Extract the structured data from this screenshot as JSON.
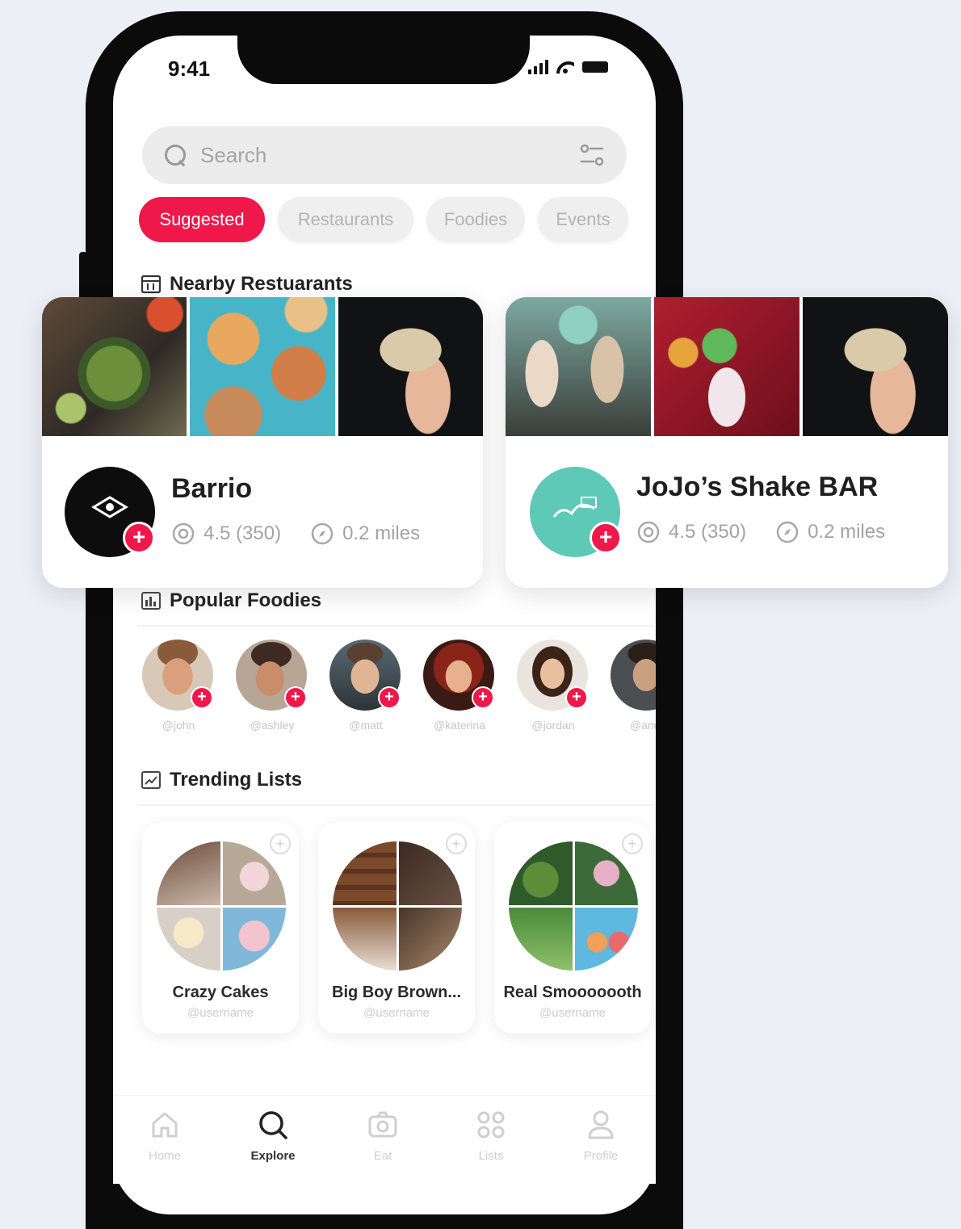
{
  "status": {
    "time": "9:41"
  },
  "search": {
    "placeholder": "Search"
  },
  "chips": [
    "Suggested",
    "Restaurants",
    "Foodies",
    "Events"
  ],
  "sections": {
    "nearby": "Nearby Restuarants",
    "foodies": "Popular Foodies",
    "trending": "Trending Lists"
  },
  "restaurants": [
    {
      "name": "Barrio",
      "rating": "4.5 (350)",
      "distance": "0.2 miles"
    },
    {
      "name": "JoJo’s Shake BAR",
      "rating": "4.5 (350)",
      "distance": "0.2 miles"
    }
  ],
  "foodies": [
    {
      "handle": "@john"
    },
    {
      "handle": "@ashley"
    },
    {
      "handle": "@matt"
    },
    {
      "handle": "@katerina"
    },
    {
      "handle": "@jordan"
    },
    {
      "handle": "@andr"
    }
  ],
  "lists": [
    {
      "title": "Crazy Cakes",
      "user": "@username"
    },
    {
      "title": "Big Boy Brown...",
      "user": "@username"
    },
    {
      "title": "Real Smooooooth",
      "user": "@username"
    }
  ],
  "tabs": [
    "Home",
    "Explore",
    "Eat",
    "Lists",
    "Profile"
  ],
  "colors": {
    "accent": "#f0174a",
    "jojo_logo": "#5ec9b6"
  }
}
